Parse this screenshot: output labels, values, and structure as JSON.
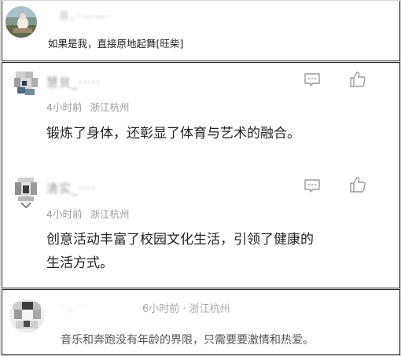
{
  "comments": [
    {
      "username": "　茶、··——··",
      "time": "",
      "location": "",
      "text": "如果是我，直接原地起舞[旺柴]"
    },
    {
      "username": "慧贫_·····",
      "time": "4小时前",
      "location": "浙江杭州",
      "text": "锻炼了身体，还彰显了体育与艺术的融合。"
    },
    {
      "username": "清实_····",
      "time": "4小时前",
      "location": "浙江杭州",
      "text_line1": "创意活动丰富了校园文化生活，引领了健康的",
      "text_line2": "生活方式。"
    },
    {
      "username": "··_···",
      "time_location": "6小时前 · 浙江杭州",
      "text": "音乐和奔跑没有年龄的界限，只需要要激情和热爱。"
    }
  ],
  "icons": {
    "reply": "comment-icon",
    "like": "thumbs-up-icon"
  },
  "colors": {
    "meta": "#9a9a9a",
    "text": "#222222",
    "icon": "#9a9a9a",
    "border": "#222222"
  }
}
